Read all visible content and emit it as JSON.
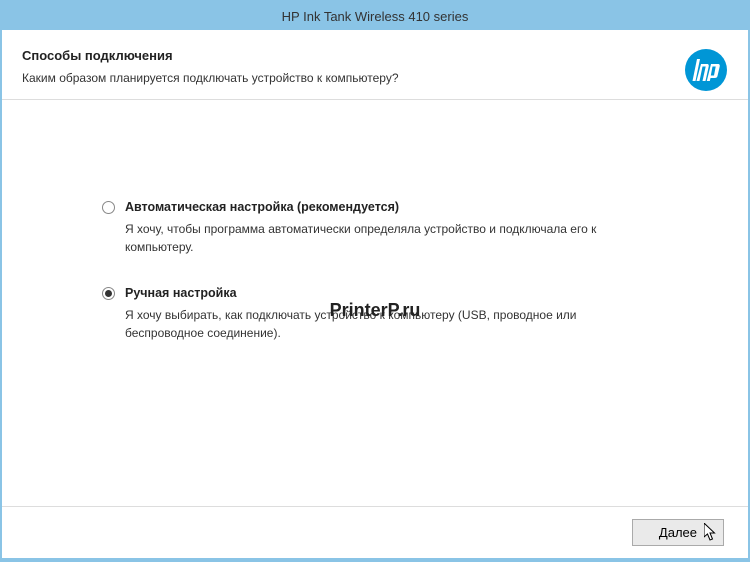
{
  "titlebar": {
    "title": "HP Ink Tank Wireless 410 series"
  },
  "header": {
    "title": "Способы подключения",
    "subtitle": "Каким образом планируется подключать устройство к компьютеру?"
  },
  "options": {
    "auto": {
      "label": "Автоматическая настройка (рекомендуется)",
      "description": "Я хочу, чтобы программа автоматически определяла устройство и подключала его к компьютеру.",
      "selected": false
    },
    "manual": {
      "label": "Ручная настройка",
      "description": "Я хочу выбирать, как подключать устройство к компьютеру (USB, проводное или беспроводное соединение).",
      "selected": true
    }
  },
  "watermark": "PrinterP.ru",
  "footer": {
    "next_label": "Далее"
  }
}
